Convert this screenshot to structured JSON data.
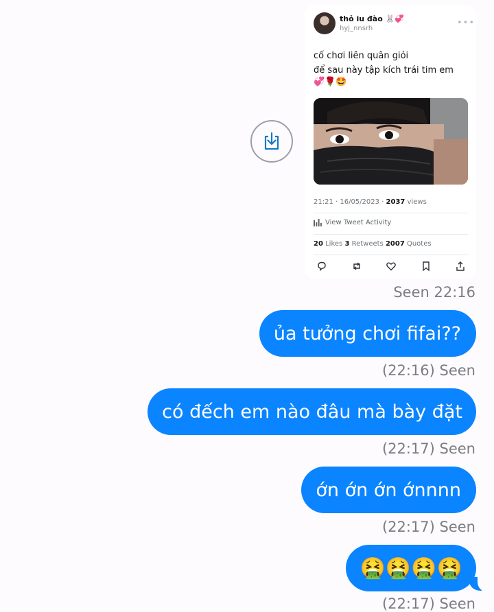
{
  "tweet": {
    "display_name": "thỏ iu đào 🐰💞",
    "handle": "hyj_nnsrh",
    "text_line1": "cố chơi liên quân giỏi",
    "text_line2": "để sau này tập kích trái tim em",
    "text_emojis": "💞🌹🤩",
    "time": "21:21 · 16/05/2023 · ",
    "views_count": "2037",
    "views_label": " views",
    "activity_label": "View Tweet Activity",
    "likes_count": "20",
    "likes_label": " Likes  ",
    "retweets_count": "3",
    "retweets_label": " Retweets  ",
    "quotes_count": "2007",
    "quotes_label": " Quotes"
  },
  "messages": [
    {
      "receipt": "Seen 22:16"
    },
    {
      "text": "ủa tưởng chơi fifai??",
      "receipt": "(22:16) Seen"
    },
    {
      "text": "có đếch em nào đâu mà bày đặt",
      "receipt": "(22:17) Seen"
    },
    {
      "text": "ớn ớn ớn ớnnnn",
      "receipt": "(22:17) Seen"
    },
    {
      "text": "🤮🤮🤮🤮",
      "receipt": "(22:17) Seen"
    }
  ],
  "colors": {
    "bubble": "#0a84ff",
    "receipt": "#7b7d82"
  },
  "icons": [
    "download-icon",
    "reply-icon",
    "retweet-icon",
    "like-icon",
    "bookmark-icon",
    "share-icon",
    "analytics-icon",
    "more-icon"
  ]
}
